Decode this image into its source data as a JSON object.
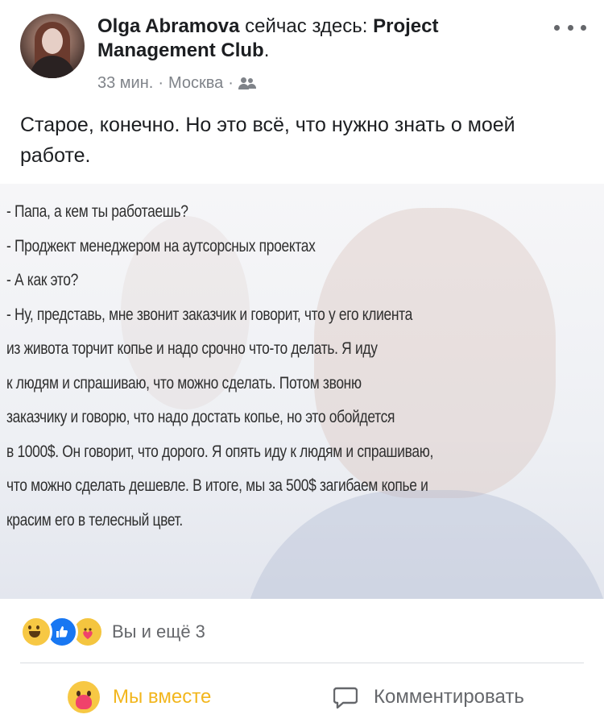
{
  "post": {
    "author": "Olga Abramova",
    "status_text": " сейчас здесь: ",
    "location_place": "Project Management Club",
    "period": ".",
    "time": "33 мин.",
    "separator": "·",
    "city": "Москва",
    "separator2": "·",
    "audience_icon": "people-icon",
    "text": "Старое, конечно. Но это всё, что нужно знать о моей работе."
  },
  "image_text": {
    "lines": [
      "- Папа, а кем ты работаешь?",
      "- Проджект менеджером на аутсорсных проектах",
      "- А как это?",
      "- Ну, представь, мне звонит заказчик и говорит, что у его клиента",
      "из живота торчит копье и надо срочно что-то делать. Я иду",
      "к людям и спрашиваю, что можно сделать. Потом звоню",
      "заказчику и говорю, что надо достать копье, но это обойдется",
      "в 1000$. Он говорит, что дорого. Я опять иду к людям и спрашиваю,",
      "что можно сделать дешевле. В итоге, мы за 500$ загибаем копье и",
      "красим его в телесный цвет."
    ]
  },
  "reactions": {
    "icons": [
      "haha-icon",
      "like-icon",
      "care-icon"
    ],
    "summary": "Вы и ещё 3"
  },
  "actions": {
    "care_label": "Мы вместе",
    "comment_label": "Комментировать"
  },
  "colors": {
    "care_active": "#f2b61d",
    "like_blue": "#1877f2",
    "muted_text": "#65676b"
  }
}
